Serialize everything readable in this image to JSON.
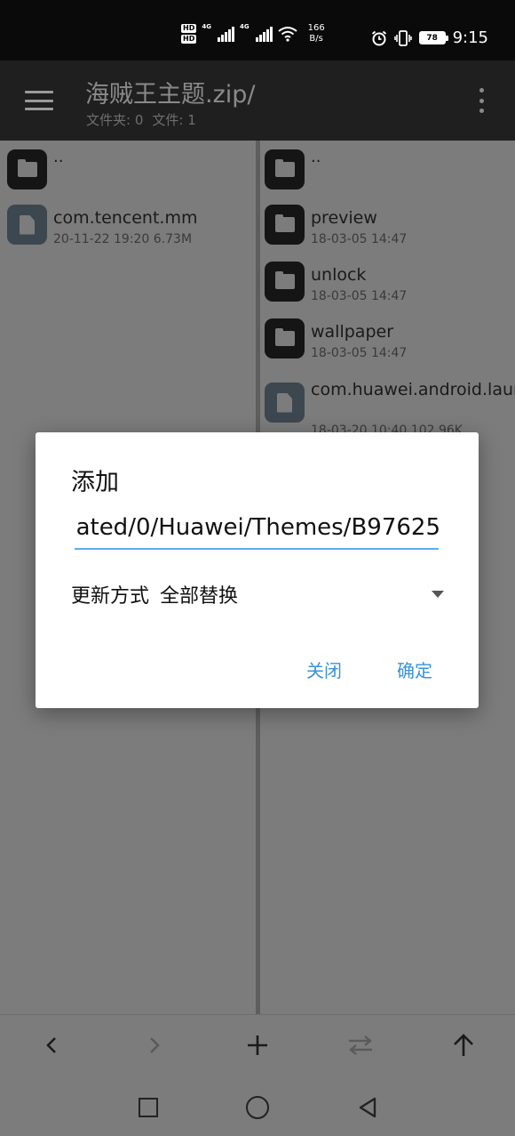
{
  "status_bar": {
    "hd1": "HD",
    "hd2": "HD",
    "sig1": "4G",
    "sig2": "4G",
    "speed_value": "166",
    "speed_unit": "B/s",
    "battery": "78",
    "time": "9:15"
  },
  "app_bar": {
    "title": "海贼王主题.zip/",
    "folders_label": "文件夹: 0",
    "files_label": "文件: 1"
  },
  "left_pane": {
    "items": [
      {
        "name": "..",
        "type": "folder"
      },
      {
        "name": "com.tencent.mm",
        "meta": "20-11-22 19:20  6.73M",
        "type": "file"
      }
    ]
  },
  "right_pane": {
    "items": [
      {
        "name": "..",
        "type": "folder"
      },
      {
        "name": "preview",
        "meta": "18-03-05 14:47",
        "type": "folder"
      },
      {
        "name": "unlock",
        "meta": "18-03-05 14:47",
        "type": "folder"
      },
      {
        "name": "wallpaper",
        "meta": "18-03-05 14:47",
        "type": "folder"
      },
      {
        "name": "com.huawei.android.launcher",
        "meta": "18-03-20 10:40  102.96K",
        "type": "file"
      }
    ]
  },
  "dialog": {
    "title": "添加",
    "path_value": "ated/0/Huawei/Themes/B97625",
    "mode_label": "更新方式",
    "mode_value": "全部替换",
    "close_label": "关闭",
    "confirm_label": "确定"
  },
  "toolbar": {
    "back_icon": "chevron-left-icon",
    "forward_icon": "chevron-right-icon",
    "add_icon": "plus-icon",
    "swap_icon": "swap-icon",
    "up_icon": "arrow-up-icon"
  },
  "colors": {
    "accent": "#3b93d6",
    "input_underline": "#5aaee6",
    "app_bar": "#1f1f1f",
    "status_bar": "#0a0a0a"
  }
}
